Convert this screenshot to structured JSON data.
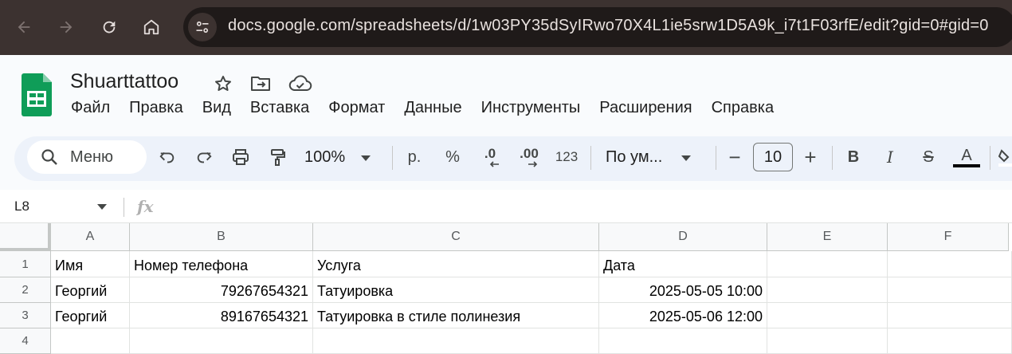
{
  "browser": {
    "url": "docs.google.com/spreadsheets/d/1w03PY35dSyIRwo70X4L1ie5srw1D5A9k_i7t1F03rfE/edit?gid=0#gid=0"
  },
  "app": {
    "title": "Shuarttattoo",
    "menu": [
      "Файл",
      "Правка",
      "Вид",
      "Вставка",
      "Формат",
      "Данные",
      "Инструменты",
      "Расширения",
      "Справка"
    ]
  },
  "toolbar": {
    "search_label": "Меню",
    "zoom": "100%",
    "currency": "р.",
    "percent": "%",
    "decrease_decimals": ".0",
    "increase_decimals": ".00",
    "number_format": "123",
    "font_family": "По ум...",
    "font_size": "10",
    "minus": "−",
    "plus": "+",
    "bold": "B",
    "italic": "I",
    "strike": "S",
    "text_color": "A"
  },
  "formula_bar": {
    "cell_ref": "L8",
    "fx": "fx"
  },
  "sheet": {
    "columns": [
      "A",
      "B",
      "C",
      "D",
      "E",
      "F"
    ],
    "rows": [
      "1",
      "2",
      "3",
      "4"
    ],
    "cells": [
      [
        "Имя",
        "Номер телефона",
        "Услуга",
        "Дата",
        "",
        ""
      ],
      [
        "Георгий",
        "79267654321",
        "Татуировка",
        "2025-05-05 10:00",
        "",
        ""
      ],
      [
        "Георгий",
        "89167654321",
        "Татуировка в стиле полинезия",
        "2025-05-06 12:00",
        "",
        ""
      ],
      [
        "",
        "",
        "",
        "",
        "",
        ""
      ]
    ]
  },
  "colors": {
    "chrome": "#3c3230",
    "sheets_green": "#0f9d58",
    "toolbar_bg": "#edf2fa"
  }
}
